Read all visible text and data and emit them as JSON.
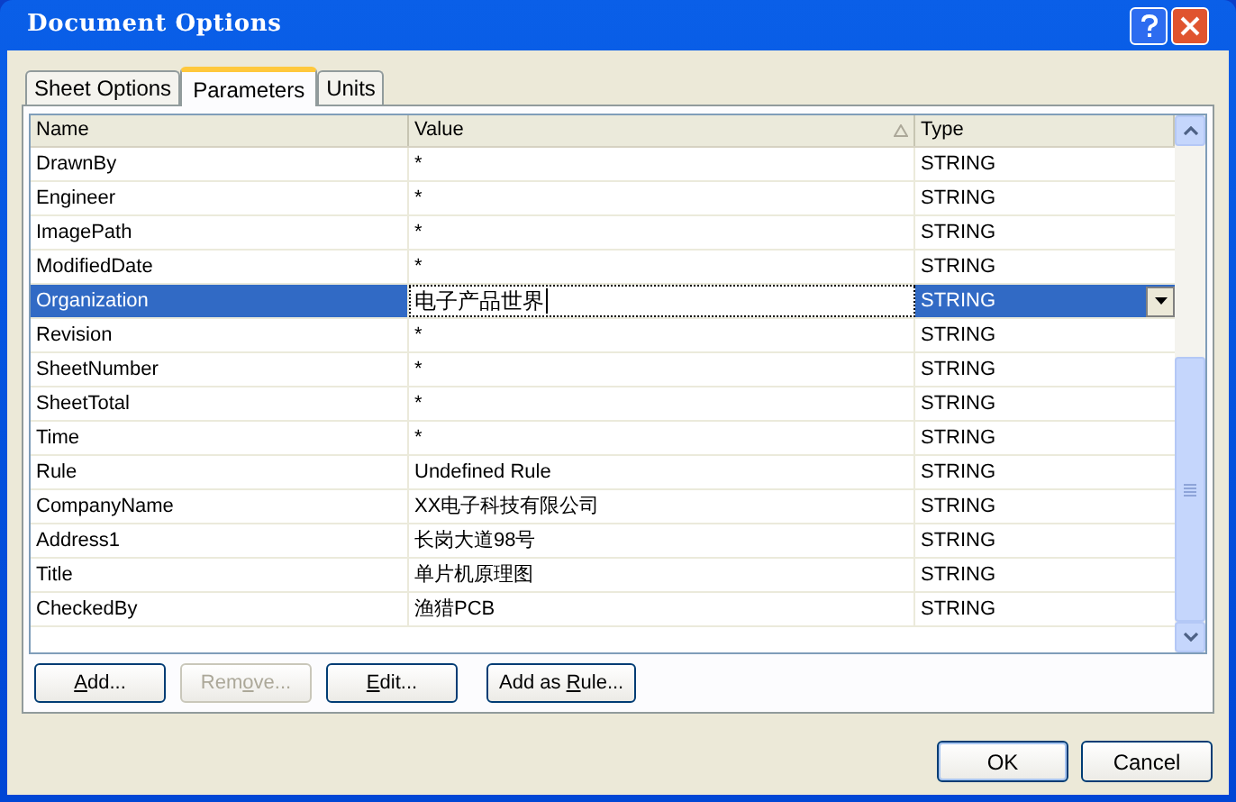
{
  "window": {
    "title": "Document Options"
  },
  "tabs": [
    {
      "label": "Sheet Options",
      "selected": false
    },
    {
      "label": "Parameters",
      "selected": true
    },
    {
      "label": "Units",
      "selected": false
    }
  ],
  "table": {
    "columns": [
      {
        "label": "Name",
        "sorted": false
      },
      {
        "label": "Value",
        "sorted": true
      },
      {
        "label": "Type",
        "sorted": false
      }
    ],
    "rows": [
      {
        "name": "DrawnBy",
        "value": "*",
        "type": "STRING",
        "selected": false
      },
      {
        "name": "Engineer",
        "value": "*",
        "type": "STRING",
        "selected": false
      },
      {
        "name": "ImagePath",
        "value": "*",
        "type": "STRING",
        "selected": false
      },
      {
        "name": "ModifiedDate",
        "value": "*",
        "type": "STRING",
        "selected": false
      },
      {
        "name": "Organization",
        "value": "电子产品世界",
        "type": "STRING",
        "selected": true
      },
      {
        "name": "Revision",
        "value": "*",
        "type": "STRING",
        "selected": false
      },
      {
        "name": "SheetNumber",
        "value": "*",
        "type": "STRING",
        "selected": false
      },
      {
        "name": "SheetTotal",
        "value": "*",
        "type": "STRING",
        "selected": false
      },
      {
        "name": "Time",
        "value": "*",
        "type": "STRING",
        "selected": false
      },
      {
        "name": "Rule",
        "value": "Undefined Rule",
        "type": "STRING",
        "selected": false
      },
      {
        "name": "CompanyName",
        "value": "XX电子科技有限公司",
        "type": "STRING",
        "selected": false
      },
      {
        "name": "Address1",
        "value": "长岗大道98号",
        "type": "STRING",
        "selected": false
      },
      {
        "name": "Title",
        "value": "单片机原理图",
        "type": "STRING",
        "selected": false
      },
      {
        "name": "CheckedBy",
        "value": "渔猎PCB",
        "type": "STRING",
        "selected": false
      }
    ]
  },
  "actions": [
    {
      "key": "A",
      "after": "dd...",
      "disabled": false
    },
    {
      "before": "Rem",
      "key": "o",
      "after": "ve...",
      "disabled": true
    },
    {
      "key": "E",
      "after": "dit...",
      "disabled": false
    },
    {
      "before": "Add as ",
      "key": "R",
      "after": "ule...",
      "disabled": false
    }
  ],
  "dialog_buttons": [
    "OK",
    "Cancel"
  ]
}
